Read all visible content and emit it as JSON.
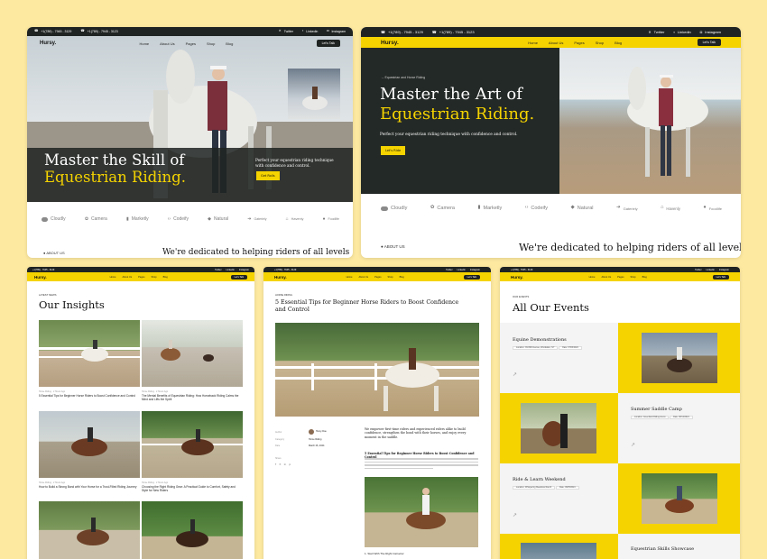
{
  "brand": "Hursy.",
  "topbar": {
    "phone": "+1(789) - 7945 - 3129",
    "phone2": "+1(789) - 7945 - 3123",
    "social": [
      "Twitter",
      "Linkedin",
      "Instagram"
    ]
  },
  "nav": {
    "links": [
      "Home",
      "About Us",
      "Pages",
      "Shop",
      "Blog"
    ],
    "cta": "Let's Talk"
  },
  "hero1": {
    "line1": "Master the Skill of",
    "line2": "Equestrian Riding.",
    "desc": "Perfect your equestrian riding technique with confidence and control.",
    "btn": "Get Rolls"
  },
  "hero2": {
    "eyebrow": "Equestrian and Horse Riding",
    "line1": "Master the Art of",
    "line2": "Equestrian Riding.",
    "desc": "Perfect your equestrian riding technique with confidence and control.",
    "btn": "Let's Ride"
  },
  "partners": [
    "Cloudly",
    "Camera",
    "Marketly",
    "Codeify",
    "Natural",
    "Gateriely",
    "Havenly",
    "Foodlife"
  ],
  "about": {
    "label": "ABOUT US",
    "tagline": "We're dedicated to helping riders of all levels"
  },
  "insights": {
    "eyebrow": "LATEST NEWS",
    "title": "Our Insights",
    "posts": [
      {
        "meta": "Horse Riding · 2 Hours Ago",
        "title": "5 Essential Tips for Beginner Horse Riders to Boost Confidence and Control"
      },
      {
        "meta": "Horse Riding · 2 Hours Ago",
        "title": "The Mental Benefits of Equestrian Riding: How Horseback Riding Calms the Mind and Lifts the Spirit"
      },
      {
        "meta": "Horse Riding · 2 Hours Ago",
        "title": "How to Build a Strong Bond with Your Horse for a Trust-Filled Riding Journey"
      },
      {
        "meta": "Horse Riding · 2 Hours Ago",
        "title": "Choosing the Right Riding Gear: A Practical Guide to Comfort, Safety and Style for New Riders"
      }
    ]
  },
  "article": {
    "eyebrow": "HORSE RIDING",
    "title": "5 Essential Tips for Beginner Horse Riders to Boost Confidence and Control",
    "intro": "We empower first-time riders and experienced riders alike to build confidence, strengthen the bond with their horses, and enjoy every moment in the saddle.",
    "subhead": "5 Essential Tips for Beginner Horse Riders to Boost Confidence and Control",
    "author_labels": [
      "Author",
      "Category",
      "Date"
    ],
    "author_values": [
      "Hursy Doe",
      "Horse Riding",
      "March 26, 2024"
    ],
    "share": "Share",
    "caption": "1. Start With The Right Instructor"
  },
  "events": {
    "eyebrow": "OUR EVENTS",
    "title": "All Our Events",
    "items": [
      {
        "title": "Equine Demonstrations",
        "loc_label": "Location",
        "loc": "Old Mill Avenue, Woodallen, NY",
        "date_label": "Date",
        "date": "07/06/2024"
      },
      {
        "title": "Summer Saddle Camp",
        "loc_label": "Location",
        "loc": "Greenfield Riding Arena",
        "date_label": "Date",
        "date": "08/12/2024"
      },
      {
        "title": "Ride & Learn Weekend",
        "loc_label": "Location",
        "loc": "Whispering Meadows Ranch",
        "date_label": "Date",
        "date": "09/05/2024"
      },
      {
        "title": "Equestrian Skills Showcase"
      }
    ]
  }
}
